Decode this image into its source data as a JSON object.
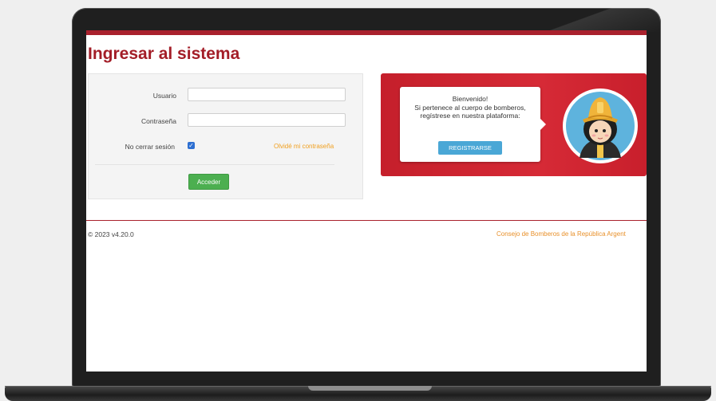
{
  "page": {
    "title": "Ingresar al sistema"
  },
  "login": {
    "username_label": "Usuario",
    "username_value": "",
    "password_label": "Contraseña",
    "password_value": "",
    "remember_label": "No cerrar sesión",
    "remember_checked": true,
    "forgot_link": "Olvidé mi contraseña",
    "submit_label": "Acceder"
  },
  "welcome": {
    "line1": "Bienvenido!",
    "line2": "Si pertenece al cuerpo de bomberos, regístrese en nuestra plataforma:",
    "register_label": "REGISTRARSE"
  },
  "footer": {
    "version": "© 2023 v4.20.0",
    "organization": "Consejo de Bomberos de la República Argent"
  },
  "colors": {
    "brand_red": "#a31d27",
    "banner_red": "#d62a36",
    "link_orange": "#f0a020",
    "submit_green": "#4caf50",
    "register_blue": "#4aa7d6"
  },
  "icons": {
    "avatar": "firefighter-avatar-icon",
    "checkbox": "check-icon"
  }
}
